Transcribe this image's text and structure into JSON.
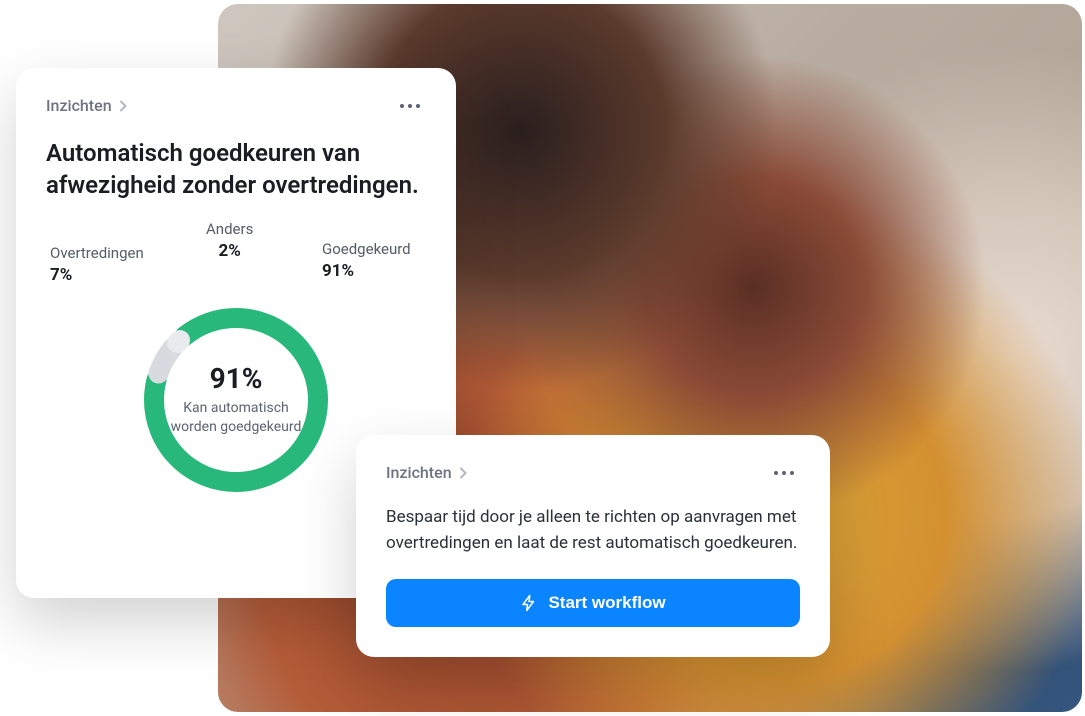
{
  "breadcrumb_label": "Inzichten",
  "insights_card": {
    "title": "Automatisch goedkeuren van afwezigheid zonder overtredingen.",
    "center_value": "91%",
    "center_caption": "Kan automatisch worden goedgekeurd"
  },
  "action_card": {
    "description": "Bespaar tijd door je alleen te richten op aanvragen met overtredingen en laat de rest automatisch goedkeuren.",
    "cta_label": "Start workflow"
  },
  "chart_data": {
    "type": "pie",
    "title": "Automatisch goedkeuren van afwezigheid zonder overtredingen.",
    "series": [
      {
        "name": "Goedgekeurd",
        "value": 91,
        "label": "Goedgekeurd",
        "pct_label": "91%",
        "color": "#28b87b"
      },
      {
        "name": "Overtredingen",
        "value": 7,
        "label": "Overtredingen",
        "pct_label": "7%",
        "color": "#d7dbe0"
      },
      {
        "name": "Anders",
        "value": 2,
        "label": "Anders",
        "pct_label": "2%",
        "color": "#e8ebee"
      }
    ],
    "center": {
      "value": "91%",
      "caption": "Kan automatisch worden goedgekeurd"
    }
  },
  "colors": {
    "accent_green": "#28b87b",
    "accent_blue": "#0a84ff",
    "grey_segment_dark": "#d7dbe0",
    "grey_segment_light": "#e8ebee"
  }
}
